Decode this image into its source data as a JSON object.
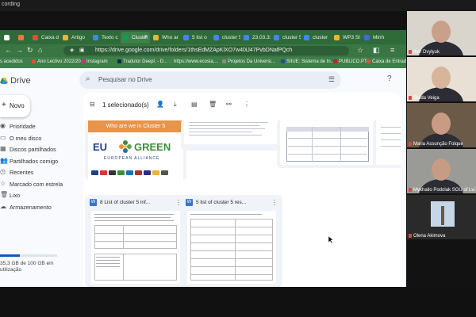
{
  "recording_label": "cording",
  "browser": {
    "tabs": [
      {
        "label": "",
        "color": "#ffffff"
      },
      {
        "label": "",
        "color": "#ff7139"
      },
      {
        "label": "Caixa d",
        "color": "#e44d3a"
      },
      {
        "label": "Artigo",
        "color": "#f2b134"
      },
      {
        "label": "Texto c",
        "color": "#4285f4"
      },
      {
        "label": "Cluster",
        "color": "#0f9d58"
      },
      {
        "label": "Who ar",
        "color": "#f2b134"
      },
      {
        "label": "5 list o",
        "color": "#4285f4"
      },
      {
        "label": "cluster 5",
        "color": "#4285f4"
      },
      {
        "label": "23.03.31",
        "color": "#4285f4"
      },
      {
        "label": "cluster 5",
        "color": "#4285f4"
      },
      {
        "label": "cluster",
        "color": "#4285f4"
      },
      {
        "label": "WP3 Sl",
        "color": "#f2b134"
      },
      {
        "label": "Minh",
        "color": "#3f6ad8"
      }
    ],
    "active_tab_close": "×",
    "url": "https://drive.google.com/drive/folders/1thsEdMZApKlXO7w40iJ47PvbDNafPQch",
    "bookmarks": [
      {
        "label": "s acedidos",
        "color": ""
      },
      {
        "label": "Ano Lectivo 2022/20...",
        "color": "#e44d3a"
      },
      {
        "label": "Instagram",
        "color": "#c13584"
      },
      {
        "label": "Tradutor Deepl. - D...",
        "color": "#0f2b46"
      },
      {
        "label": "https://www.ecosia....",
        "color": "#3c8d40"
      },
      {
        "label": "Projetos Da Universi...",
        "color": "#8a8a8a"
      },
      {
        "label": "SIIUE: Sistema de In...",
        "color": "#1f4fa0"
      },
      {
        "label": "PUBLICO.PT",
        "color": "#c81d25"
      },
      {
        "label": "Caixa de Entrada",
        "color": "#e44d3a"
      }
    ]
  },
  "drive": {
    "app_name": "Drive",
    "search_placeholder": "Pesquisar no Drive",
    "new_button": "Novo",
    "nav": [
      {
        "label": "Prioridade",
        "icon": "check-circle-icon"
      },
      {
        "label": "O meu disco",
        "icon": "drive-folder-icon"
      },
      {
        "label": "Discos partilhados",
        "icon": "shared-drive-icon"
      },
      {
        "label": "Partilhados comigo",
        "icon": "people-icon"
      },
      {
        "label": "Recentes",
        "icon": "clock-icon"
      },
      {
        "label": "Marcado com estrela",
        "icon": "star-icon"
      },
      {
        "label": "Lixo",
        "icon": "trash-icon"
      },
      {
        "label": "Armazenamento",
        "icon": "cloud-icon"
      }
    ],
    "storage_used_fraction": 0.35,
    "storage_text_line1": "35,3 GB de 100 GB em",
    "storage_text_line2": "utilização",
    "selection_count": "1 selecionado(s)",
    "cards": {
      "cluster_band": "Who are we in Cluster 5",
      "eu_text": "EU",
      "green_text": "GREEN",
      "alliance_text": "EUROPEAN ALLIANCE",
      "doc1_title": "8 List of cluster 5 inf...",
      "doc2_title": "5 list of cluster 5 res..."
    }
  },
  "participants": [
    {
      "name": "Ihor Dvylyuk",
      "skin": "#c9a08a",
      "bg": "#d9d4cc"
    },
    {
      "name": "Guida Veiga",
      "skin": "#d8b49a",
      "bg": "#e8e0d4"
    },
    {
      "name": "Maria Assunção Folque",
      "skin": "#c99a84",
      "bg": "#6b5a48"
    },
    {
      "name": "Mykhailo Podolak SGU of Lvi",
      "skin": "#c89b85",
      "bg": "#9a9a96"
    },
    {
      "name": "Olena Akimova",
      "skin": "#c6d6e6",
      "bg": "#2a2a2a"
    }
  ]
}
